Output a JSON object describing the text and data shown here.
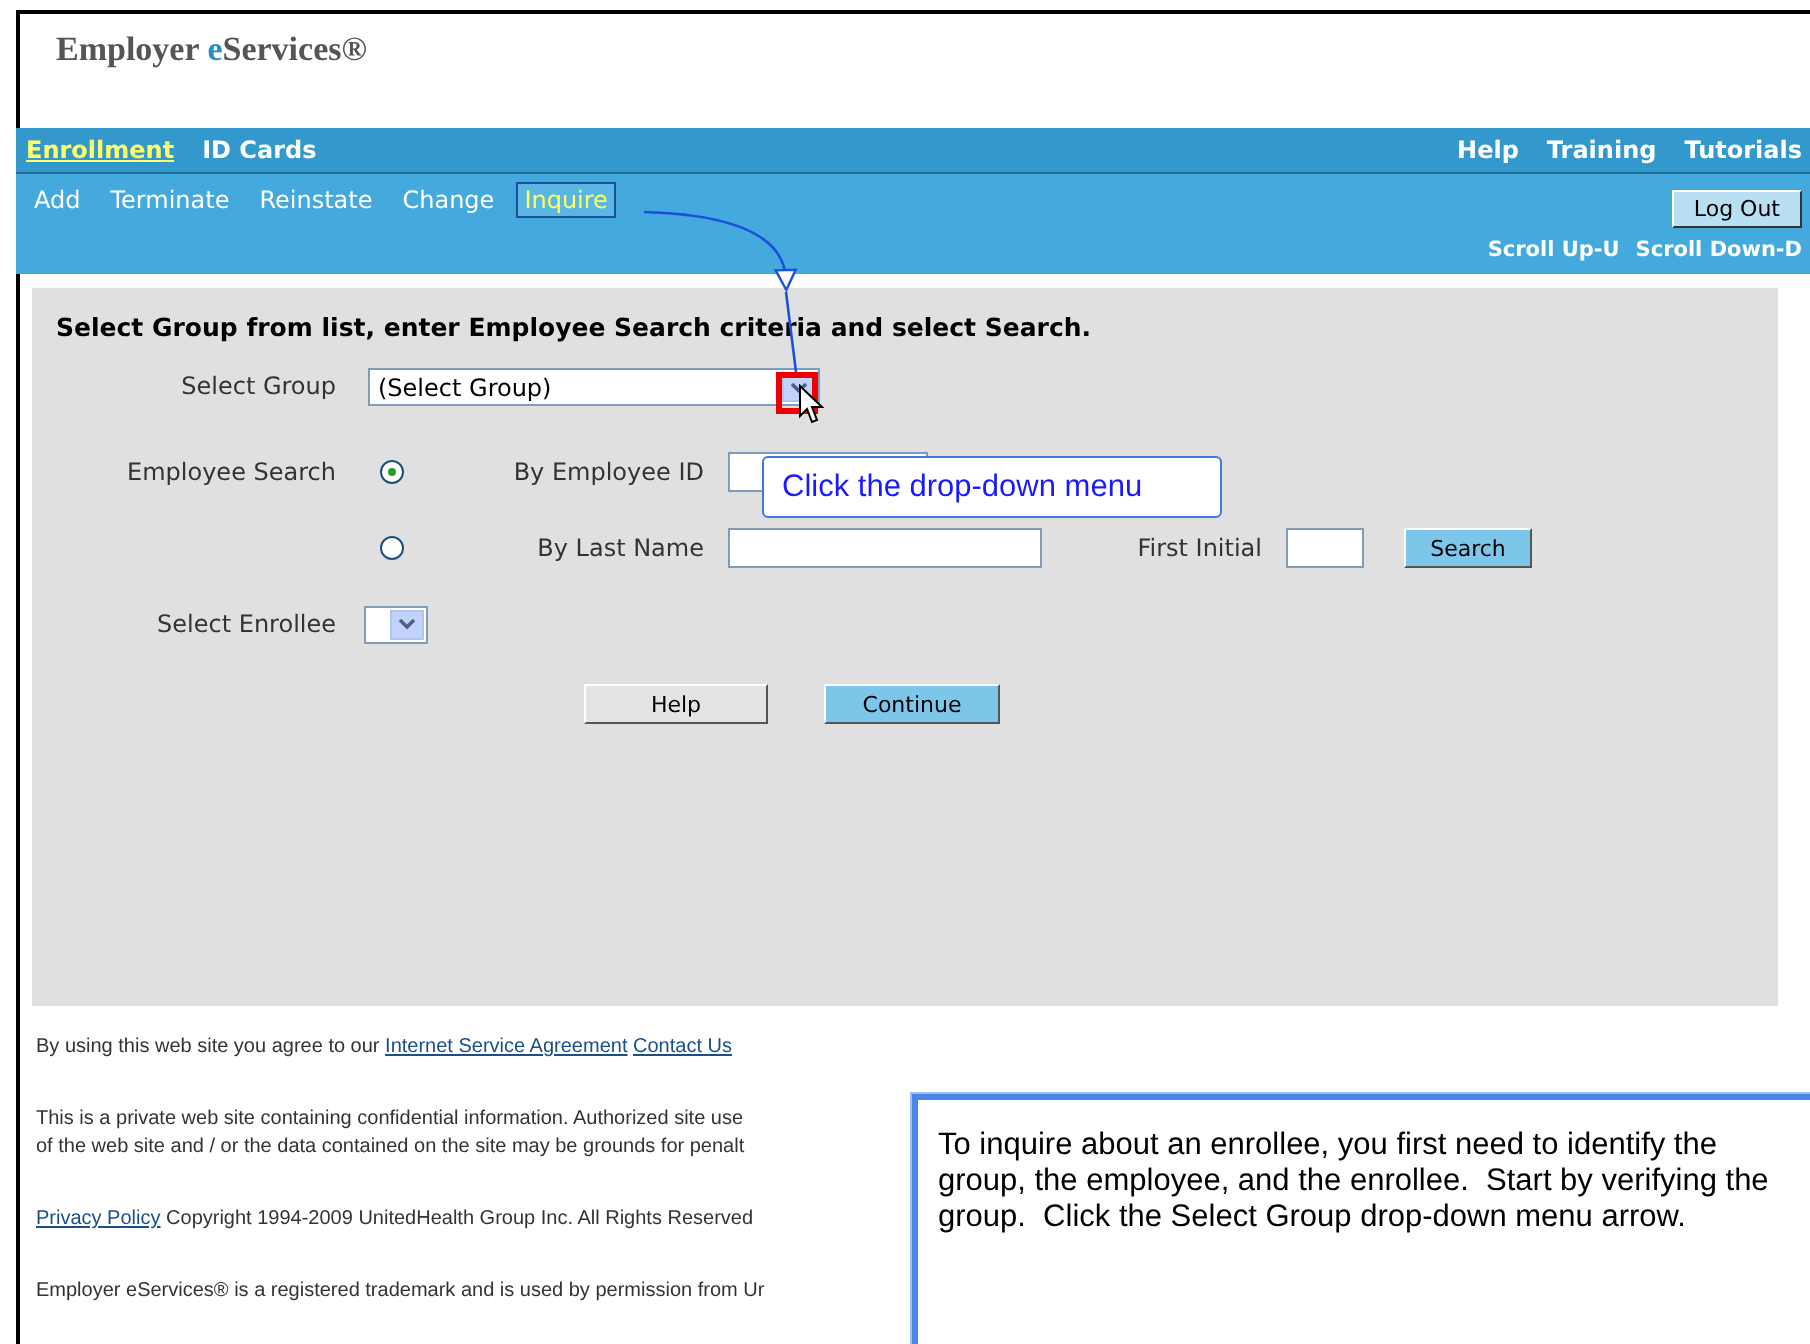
{
  "logo": {
    "prefix": "Employer ",
    "accent": "e",
    "rest": "Services®"
  },
  "main_nav": [
    {
      "label": "Enrollment",
      "selected": true
    },
    {
      "label": "ID Cards",
      "selected": false
    }
  ],
  "utility_nav": [
    "Help",
    "Training",
    "Tutorials"
  ],
  "sub_nav": [
    {
      "label": "Add",
      "selected": false
    },
    {
      "label": "Terminate",
      "selected": false
    },
    {
      "label": "Reinstate",
      "selected": false
    },
    {
      "label": "Change",
      "selected": false
    },
    {
      "label": "Inquire",
      "selected": true
    }
  ],
  "logout_button": "Log Out",
  "scroll_links": [
    "Scroll Up-U",
    "Scroll Down-D"
  ],
  "form": {
    "instructions": "Select Group from list, enter Employee Search criteria and select Search.",
    "select_group": {
      "label": "Select Group",
      "value": "(Select Group)"
    },
    "employee_search": {
      "label": "Employee Search",
      "options": [
        {
          "label": "By Employee ID",
          "selected": true
        },
        {
          "label": "By Last Name",
          "selected": false
        }
      ],
      "first_initial": "First Initial",
      "search_button": "Search"
    },
    "select_enrollee": {
      "label": "Select Enrollee"
    },
    "buttons": [
      {
        "label": "Help",
        "primary": false
      },
      {
        "label": "Continue",
        "primary": true
      }
    ]
  },
  "footer": {
    "agreement": "By using this web site you agree to our",
    "agreement_links": [
      "Internet Service Agreement",
      "Contact Us"
    ],
    "notice_lines": [
      "This is a private web site containing confidential information. Authorized site use",
      "of the web site and / or the data contained on the site may be grounds for penalt"
    ],
    "privacy_link": "Privacy Policy",
    "copyright": "Copyright 1994-2009 UnitedHealth Group Inc. All Rights Reserved",
    "trademark": "Employer eServices® is a registered trademark and is used by permission from Ur"
  },
  "tooltip": "Click the drop-down menu",
  "callout": "To inquire about an enrollee, you first need to identify the group, the employee, and the enrollee.  Start by verifying the group.  Click the Select Group drop-down menu arrow."
}
